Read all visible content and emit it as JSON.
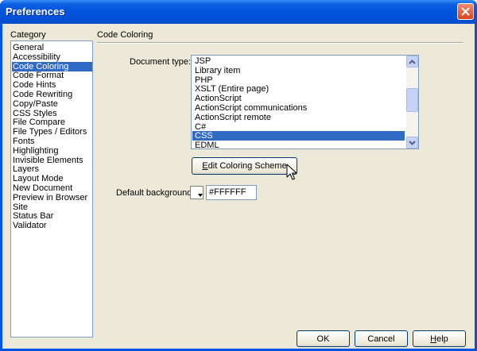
{
  "window": {
    "title": "Preferences"
  },
  "category": {
    "label": "Category",
    "items": [
      "General",
      "Accessibility",
      "Code Coloring",
      "Code Format",
      "Code Hints",
      "Code Rewriting",
      "Copy/Paste",
      "CSS Styles",
      "File Compare",
      "File Types / Editors",
      "Fonts",
      "Highlighting",
      "Invisible Elements",
      "Layers",
      "Layout Mode",
      "New Document",
      "Preview in Browser",
      "Site",
      "Status Bar",
      "Validator"
    ],
    "selected": "Code Coloring"
  },
  "panel": {
    "title": "Code Coloring",
    "document_type_label": "Document type:",
    "document_types": [
      "JSP",
      "Library item",
      "PHP",
      "XSLT (Entire page)",
      "ActionScript",
      "ActionScript communications",
      "ActionScript remote",
      "C#",
      "CSS",
      "EDML"
    ],
    "selected_document_type": "CSS",
    "edit_button": {
      "prefix": "",
      "mnemonic": "E",
      "rest": "dit Coloring Scheme"
    },
    "default_background_label": "Default background:",
    "default_background_value": "#FFFFFF"
  },
  "buttons": {
    "ok": "OK",
    "cancel": "Cancel",
    "help_mnemonic": "H",
    "help_rest": "elp"
  },
  "colors": {
    "title_bar": "#0054e3",
    "selection": "#316ac5",
    "close": "#d9451e"
  }
}
